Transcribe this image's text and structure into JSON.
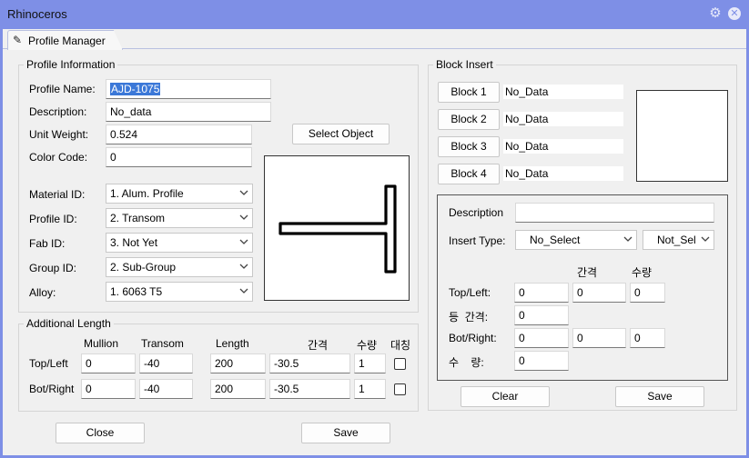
{
  "window": {
    "title": "Rhinoceros"
  },
  "tab": {
    "label": "Profile Manager"
  },
  "profile_info": {
    "legend": "Profile Information",
    "fields": [
      {
        "label": "Profile Name:",
        "value": "AJD-1075"
      },
      {
        "label": "Description:",
        "value": "No_data"
      },
      {
        "label": "Unit Weight:",
        "value": "0.524"
      },
      {
        "label": "Color Code:",
        "value": "0"
      }
    ],
    "dropdowns": [
      {
        "label": "Material ID:",
        "value": "1. Alum. Profile"
      },
      {
        "label": "Profile ID:",
        "value": "2. Transom"
      },
      {
        "label": "Fab ID:",
        "value": "3. Not Yet"
      },
      {
        "label": "Group ID:",
        "value": "2. Sub-Group"
      },
      {
        "label": "Alloy:",
        "value": "1. 6063 T5"
      }
    ],
    "select_object": "Select Object"
  },
  "additional_length": {
    "legend": "Additional Length",
    "headers": [
      "Mullion",
      "Transom",
      "Length",
      "간격",
      "수량",
      "대칭"
    ],
    "rows": [
      {
        "label": "Top/Left",
        "values": [
          "0",
          "-40",
          "200",
          "-30.5",
          "1"
        ]
      },
      {
        "label": "Bot/Right",
        "values": [
          "0",
          "-40",
          "200",
          "-30.5",
          "1"
        ]
      }
    ]
  },
  "block_insert": {
    "legend": "Block Insert",
    "blocks": [
      {
        "button": "Block 1",
        "value": "No_Data"
      },
      {
        "button": "Block 2",
        "value": "No_Data"
      },
      {
        "button": "Block 3",
        "value": "No_Data"
      },
      {
        "button": "Block 4",
        "value": "No_Data"
      }
    ],
    "description_label": "Description",
    "description_value": "",
    "insert_type_label": "Insert Type:",
    "insert_type_value": "No_Select",
    "insert_type_value2": "Not_Sel",
    "col_headers": [
      "간격",
      "수량"
    ],
    "rows": [
      {
        "label": "Top/Left:",
        "values": [
          "0",
          "0",
          "0"
        ]
      },
      {
        "label": "등  간격:",
        "values": [
          "0"
        ]
      },
      {
        "label": "Bot/Right:",
        "values": [
          "0",
          "0",
          "0"
        ]
      },
      {
        "label": "수    량:",
        "values": [
          "0"
        ]
      }
    ],
    "clear": "Clear",
    "save": "Save"
  },
  "footer": {
    "close": "Close",
    "save": "Save"
  }
}
